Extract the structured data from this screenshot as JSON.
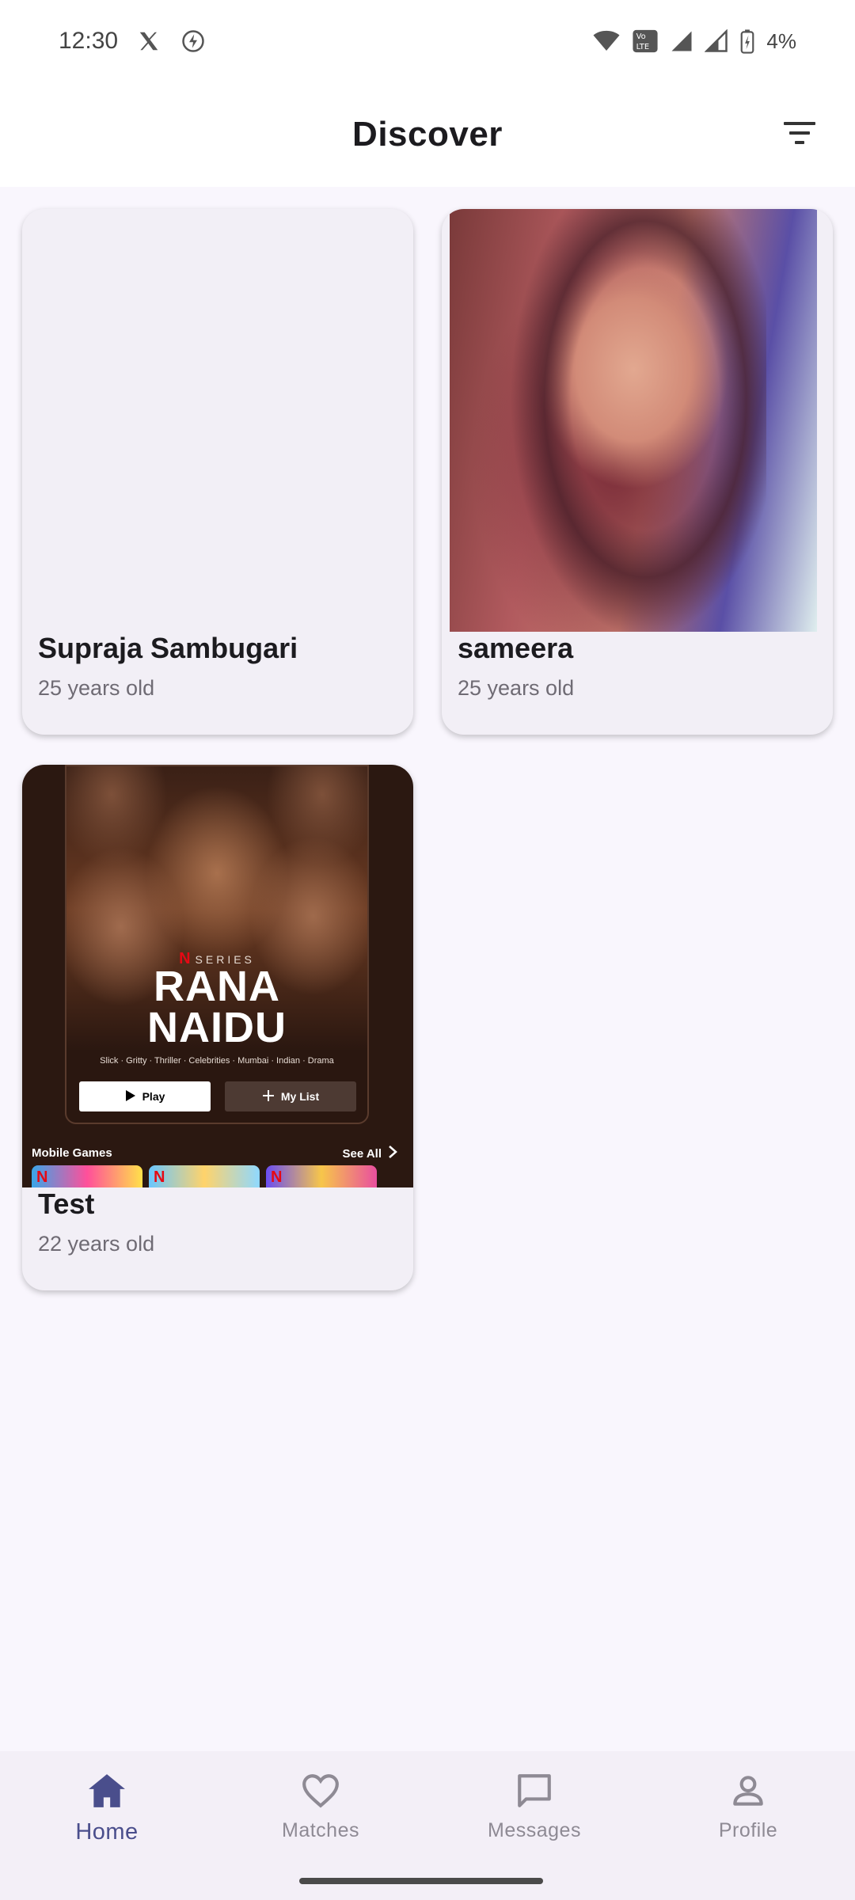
{
  "status_bar": {
    "time": "12:30",
    "battery": "4%",
    "icons": [
      "x-icon",
      "bolt-icon",
      "wifi-icon",
      "volte-icon",
      "signal-icon",
      "signal-icon-2",
      "battery-charging-icon"
    ]
  },
  "app_bar": {
    "title": "Discover",
    "filter_icon": "filter-icon"
  },
  "profiles": [
    {
      "name": "Supraja Sambugari",
      "age": "25 years old"
    },
    {
      "name": "sameera",
      "age": "25 years old"
    },
    {
      "name": "Test",
      "age": "22 years old"
    }
  ],
  "poster": {
    "series": "SERIES",
    "brand_letter": "N",
    "title": "RANA NAIDU",
    "tags": "Slick · Gritty · Thriller · Celebrities · Mumbai · Indian · Drama",
    "play": "Play",
    "my_list": "My List",
    "games": "Mobile Games",
    "see_all": "See All"
  },
  "nav": {
    "items": [
      {
        "label": "Home",
        "icon": "home-icon",
        "active": true
      },
      {
        "label": "Matches",
        "icon": "heart-icon",
        "active": false
      },
      {
        "label": "Messages",
        "icon": "chat-icon",
        "active": false
      },
      {
        "label": "Profile",
        "icon": "person-icon",
        "active": false
      }
    ]
  },
  "colors": {
    "background": "#f9f6fd",
    "card": "#f2eff6",
    "accent": "#4a4e8c",
    "nav_inactive": "#8e8a94"
  }
}
